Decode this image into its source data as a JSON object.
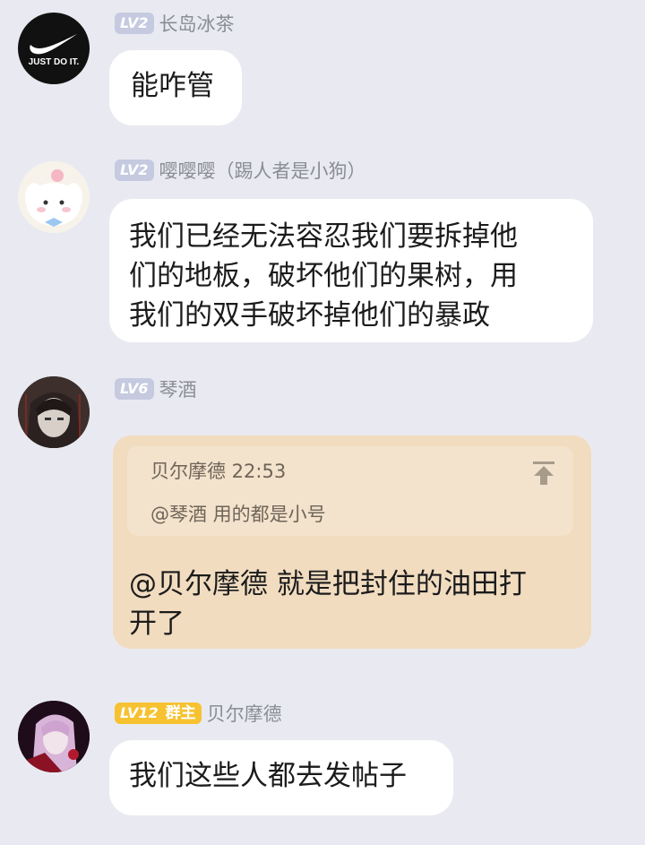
{
  "messages": [
    {
      "level": "LV2",
      "nickname": "长岛冰茶",
      "avatar_text": "JUST DO IT.",
      "text": "能咋管"
    },
    {
      "level": "LV2",
      "nickname": "嘤嘤嘤（踢人者是小狗）",
      "lines": [
        "我们已经无法容忍我们要拆掉他",
        "们的地板，破坏他们的果树，用",
        "我们的双手破坏掉他们的暴政"
      ]
    },
    {
      "level": "LV6",
      "nickname": "琴酒",
      "quote": {
        "author_time": "贝尔摩德 22:53",
        "text": "@琴酒 用的都是小号"
      },
      "reply_lines": [
        "@贝尔摩德 就是把封住的油田打",
        "开了"
      ]
    },
    {
      "level": "LV12",
      "role": "群主",
      "nickname": "贝尔摩德",
      "text": "我们这些人都去发帖子"
    }
  ],
  "colors": {
    "background": "#e9eaf1",
    "bubble": "#ffffff",
    "quote_bubble": "#f1dcc0",
    "level_badge": "#c6cae0",
    "owner_badge": "#f7c231"
  }
}
